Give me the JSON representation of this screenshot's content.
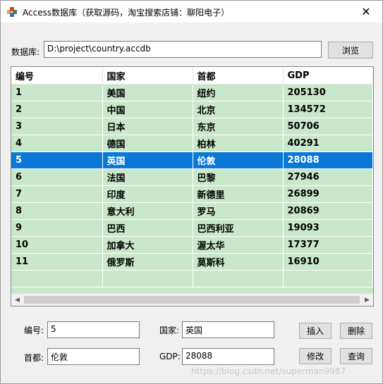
{
  "window": {
    "title": "Access数据库（获取源码，淘宝搜索店铺：聊阳电子）",
    "close_glyph": "✕"
  },
  "database": {
    "label": "数据库:",
    "path": "D:\\project\\country.accdb",
    "browse_label": "浏览"
  },
  "grid": {
    "columns": [
      "编号",
      "国家",
      "首都",
      "GDP"
    ],
    "rows": [
      [
        "1",
        "美国",
        "纽约",
        "205130"
      ],
      [
        "2",
        "中国",
        "北京",
        "134572"
      ],
      [
        "3",
        "日本",
        "东京",
        "50706"
      ],
      [
        "4",
        "德国",
        "柏林",
        "40291"
      ],
      [
        "5",
        "英国",
        "伦敦",
        "28088"
      ],
      [
        "6",
        "法国",
        "巴黎",
        "27946"
      ],
      [
        "7",
        "印度",
        "新德里",
        "26899"
      ],
      [
        "8",
        "意大利",
        "罗马",
        "20869"
      ],
      [
        "9",
        "巴西",
        "巴西利亚",
        "19093"
      ],
      [
        "10",
        "加拿大",
        "渥太华",
        "17377"
      ],
      [
        "11",
        "俄罗斯",
        "莫斯科",
        "16910"
      ]
    ],
    "selected_row_index": 4
  },
  "form": {
    "id_label": "编号:",
    "id_value": "5",
    "country_label": "国家:",
    "country_value": "英国",
    "capital_label": "首都:",
    "capital_value": "伦敦",
    "gdp_label": "GDP:",
    "gdp_value": "28088"
  },
  "buttons": {
    "insert": "插入",
    "delete": "删除",
    "modify": "修改",
    "query": "查询"
  },
  "watermark": "https://blog.csdn.net/superman9987",
  "colors": {
    "grid_background": "#c9e7cb",
    "selection": "#0a78d7"
  }
}
